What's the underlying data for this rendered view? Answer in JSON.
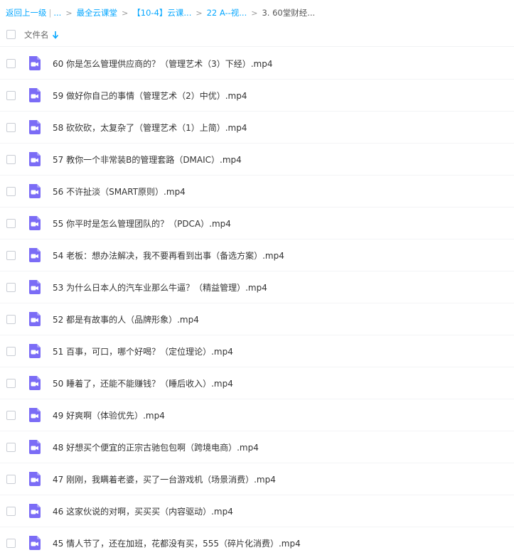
{
  "breadcrumb": {
    "back_label": "返回上一级",
    "ellipsis_label": "...",
    "items": [
      "最全云课堂",
      "【10-4】云课...",
      "22 A--视...",
      "3. 60堂财经..."
    ]
  },
  "header": {
    "column_filename": "文件名",
    "sort_icon": "arrow-down-icon"
  },
  "colors": {
    "accent": "#06a7ff",
    "video_icon": "#7b6cf6"
  },
  "files": [
    {
      "name": "60 你是怎么管理供应商的？（管理艺术（3）下经）.mp4",
      "icon": "video-file-icon"
    },
    {
      "name": "59 做好你自己的事情（管理艺术（2）中优）.mp4",
      "icon": "video-file-icon"
    },
    {
      "name": "58 砍砍砍，太复杂了（管理艺术（1）上简）.mp4",
      "icon": "video-file-icon"
    },
    {
      "name": "57 教你一个非常装B的管理套路（DMAIC）.mp4",
      "icon": "video-file-icon"
    },
    {
      "name": "56 不许扯淡（SMART原则）.mp4",
      "icon": "video-file-icon"
    },
    {
      "name": "55 你平时是怎么管理团队的？（PDCA）.mp4",
      "icon": "video-file-icon"
    },
    {
      "name": "54 老板：想办法解决，我不要再看到出事（备选方案）.mp4",
      "icon": "video-file-icon"
    },
    {
      "name": "53 为什么日本人的汽车业那么牛逼？（精益管理）.mp4",
      "icon": "video-file-icon"
    },
    {
      "name": "52 都是有故事的人（品牌形象）.mp4",
      "icon": "video-file-icon"
    },
    {
      "name": "51 百事，可口，哪个好喝？（定位理论）.mp4",
      "icon": "video-file-icon"
    },
    {
      "name": "50 睡着了，还能不能赚钱？（睡后收入）.mp4",
      "icon": "video-file-icon"
    },
    {
      "name": "49 好爽啊（体验优先）.mp4",
      "icon": "video-file-icon"
    },
    {
      "name": "48 好想买个便宜的正宗古驰包包啊（跨境电商）.mp4",
      "icon": "video-file-icon"
    },
    {
      "name": "47 刚刚，我瞒着老婆，买了一台游戏机（场景消费）.mp4",
      "icon": "video-file-icon"
    },
    {
      "name": "46 这家伙说的对啊，买买买（内容驱动）.mp4",
      "icon": "video-file-icon"
    },
    {
      "name": "45 情人节了，还在加班，花都没有买，555（碎片化消费）.mp4",
      "icon": "video-file-icon"
    }
  ]
}
